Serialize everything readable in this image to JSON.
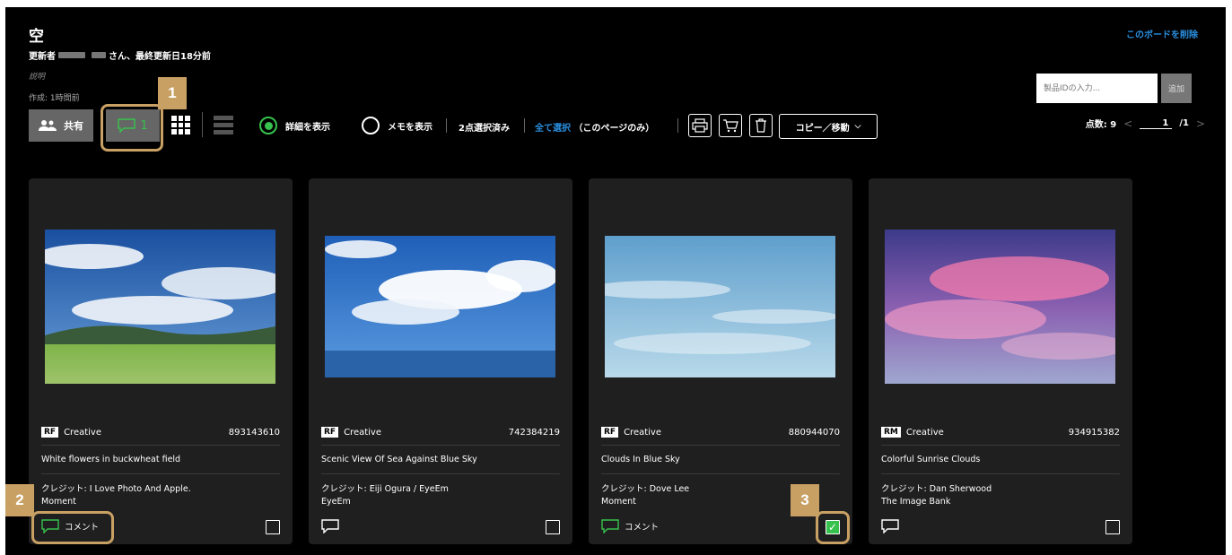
{
  "board": {
    "title": "空",
    "updated_prefix": "更新者",
    "updated_suffix": "さん、最終更新日18分前",
    "description": "説明",
    "created": "作成: 1時間前",
    "delete_link": "このボードを削除"
  },
  "product_id": {
    "placeholder": "製品IDの入力...",
    "add_label": "追加"
  },
  "pagination": {
    "count_label": "点数: 9",
    "current_page": "1",
    "total_pages": "/1"
  },
  "toolbar": {
    "share_label": "共有",
    "comment_count": "1",
    "show_details_label": "詳細を表示",
    "show_memo_label": "メモを表示",
    "selected_label": "2点選択済み",
    "select_all_label": "全て選択",
    "select_all_scope": "（このページのみ）",
    "copy_move_label": "コピー／移動"
  },
  "cards": [
    {
      "license": "RF",
      "collection": "Creative",
      "id": "893143610",
      "title": "White flowers in buckwheat field",
      "credit": "クレジット: I Love Photo And Apple.",
      "source": "Moment",
      "comment_label": "コメント",
      "checked": false
    },
    {
      "license": "RF",
      "collection": "Creative",
      "id": "742384219",
      "title": "Scenic View Of Sea Against Blue Sky",
      "credit": "クレジット: Eiji Ogura / EyeEm",
      "source": "EyeEm",
      "comment_label": "",
      "checked": false
    },
    {
      "license": "RF",
      "collection": "Creative",
      "id": "880944070",
      "title": "Clouds In Blue Sky",
      "credit": "クレジット: Dove Lee",
      "source": "Moment",
      "comment_label": "コメント",
      "checked": true
    },
    {
      "license": "RM",
      "collection": "Creative",
      "id": "934915382",
      "title": "Colorful Sunrise Clouds",
      "credit": "クレジット: Dan Sherwood",
      "source": "The Image Bank",
      "comment_label": "",
      "checked": false
    }
  ],
  "callouts": [
    "1",
    "2",
    "3"
  ],
  "colors": {
    "accent_green": "#37c24d",
    "link_blue": "#2a8fe0",
    "callout_gold": "#c8a063"
  }
}
